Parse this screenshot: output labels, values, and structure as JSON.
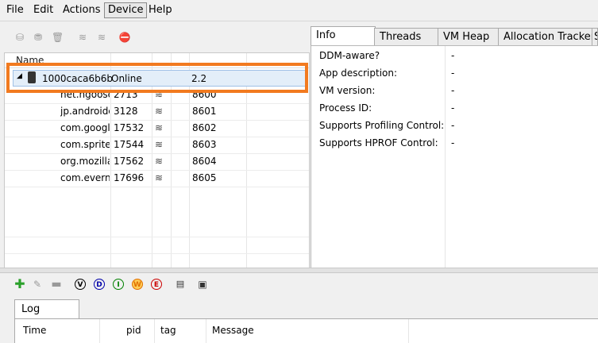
{
  "menu": {
    "file": "File",
    "edit": "Edit",
    "actions": "Actions",
    "device": "Device",
    "help": "Help"
  },
  "devices": {
    "header": {
      "name": "Name"
    },
    "device": {
      "name": "1000caca6b6b",
      "status": "Online",
      "version": "2.2"
    },
    "processes": [
      {
        "name": "net.hgoose",
        "pid": "2713",
        "port": "8600"
      },
      {
        "name": "jp.androide",
        "pid": "3128",
        "port": "8601"
      },
      {
        "name": "com.google",
        "pid": "17532",
        "port": "8602"
      },
      {
        "name": "com.sprite",
        "pid": "17544",
        "port": "8603"
      },
      {
        "name": "org.mozilla",
        "pid": "17562",
        "port": "8604"
      },
      {
        "name": "com.evern",
        "pid": "17696",
        "port": "8605"
      }
    ]
  },
  "tabs": [
    "Info",
    "Threads",
    "VM Heap",
    "Allocation Tracker",
    "S"
  ],
  "info": [
    {
      "key": "DDM-aware?",
      "value": "-"
    },
    {
      "key": "App description:",
      "value": "-"
    },
    {
      "key": "VM version:",
      "value": "-"
    },
    {
      "key": "Process ID:",
      "value": "-"
    },
    {
      "key": "Supports Profiling Control:",
      "value": "-"
    },
    {
      "key": "Supports HPROF Control:",
      "value": "-"
    }
  ],
  "log": {
    "levels": [
      "V",
      "D",
      "I",
      "W",
      "E"
    ],
    "level_colors": [
      "#000000",
      "#0000aa",
      "#008000",
      "#e07000",
      "#cc0000"
    ],
    "tab": "Log",
    "columns": {
      "time": "Time",
      "pid": "pid",
      "tag": "tag",
      "message": "Message"
    }
  }
}
